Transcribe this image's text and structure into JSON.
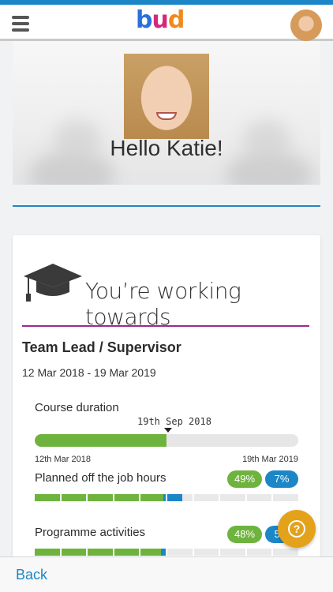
{
  "header": {
    "logo_text": [
      "b",
      "u",
      "d"
    ],
    "brand_colors": {
      "b": "#2a6fdb",
      "u": "#d6287a",
      "d": "#f08a1c"
    },
    "accent_top": "#1d86c7"
  },
  "profile": {
    "greeting": "Hello Katie!"
  },
  "programme": {
    "heading": "You’re working towards",
    "qualification": "Team Lead / Supervisor",
    "dates": "12 Mar 2018 - 19 Mar 2019",
    "course_duration": {
      "label": "Course duration",
      "marker_label": "19th Sep 2018",
      "progress": 0.5,
      "start_label": "12th Mar 2018",
      "end_label": "19th Mar 2019"
    },
    "planned_hours": {
      "label": "Planned off the job hours",
      "green_value": "49%",
      "blue_value": "7%",
      "green_fraction": 0.49,
      "blue_fraction": 0.07
    },
    "activities": {
      "label": "Programme activities",
      "green_value": "48%",
      "blue_value": "5%",
      "green_fraction": 0.48,
      "blue_fraction": 0.02
    }
  },
  "colors": {
    "green": "#6fb33f",
    "blue": "#1d86c7",
    "purple": "#9b2a8f",
    "help": "#e3a21a"
  },
  "help_button": {
    "icon": "question-icon",
    "glyph": "?"
  },
  "footer": {
    "back_label": "Back"
  }
}
